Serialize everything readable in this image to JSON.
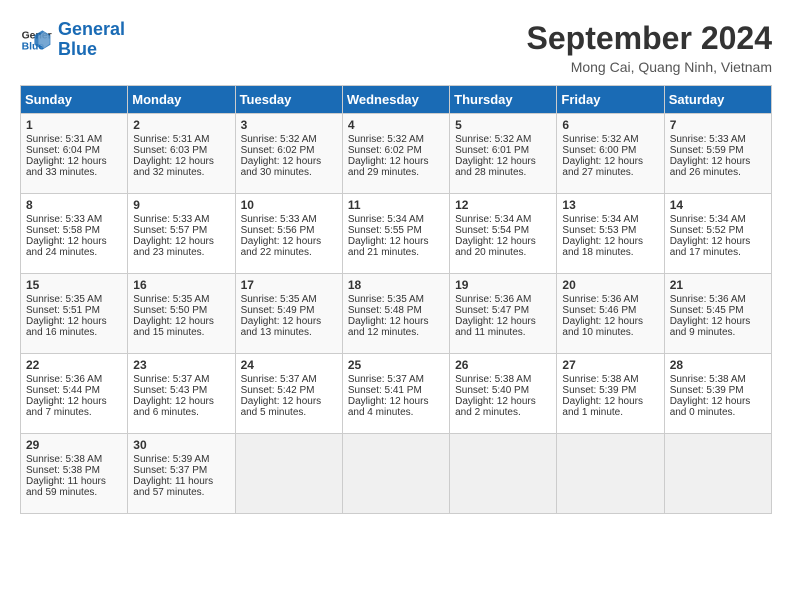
{
  "header": {
    "logo_line1": "General",
    "logo_line2": "Blue",
    "title": "September 2024",
    "subtitle": "Mong Cai, Quang Ninh, Vietnam"
  },
  "weekdays": [
    "Sunday",
    "Monday",
    "Tuesday",
    "Wednesday",
    "Thursday",
    "Friday",
    "Saturday"
  ],
  "weeks": [
    [
      {
        "day": "1",
        "lines": [
          "Sunrise: 5:31 AM",
          "Sunset: 6:04 PM",
          "Daylight: 12 hours",
          "and 33 minutes."
        ]
      },
      {
        "day": "2",
        "lines": [
          "Sunrise: 5:31 AM",
          "Sunset: 6:03 PM",
          "Daylight: 12 hours",
          "and 32 minutes."
        ]
      },
      {
        "day": "3",
        "lines": [
          "Sunrise: 5:32 AM",
          "Sunset: 6:02 PM",
          "Daylight: 12 hours",
          "and 30 minutes."
        ]
      },
      {
        "day": "4",
        "lines": [
          "Sunrise: 5:32 AM",
          "Sunset: 6:02 PM",
          "Daylight: 12 hours",
          "and 29 minutes."
        ]
      },
      {
        "day": "5",
        "lines": [
          "Sunrise: 5:32 AM",
          "Sunset: 6:01 PM",
          "Daylight: 12 hours",
          "and 28 minutes."
        ]
      },
      {
        "day": "6",
        "lines": [
          "Sunrise: 5:32 AM",
          "Sunset: 6:00 PM",
          "Daylight: 12 hours",
          "and 27 minutes."
        ]
      },
      {
        "day": "7",
        "lines": [
          "Sunrise: 5:33 AM",
          "Sunset: 5:59 PM",
          "Daylight: 12 hours",
          "and 26 minutes."
        ]
      }
    ],
    [
      {
        "day": "8",
        "lines": [
          "Sunrise: 5:33 AM",
          "Sunset: 5:58 PM",
          "Daylight: 12 hours",
          "and 24 minutes."
        ]
      },
      {
        "day": "9",
        "lines": [
          "Sunrise: 5:33 AM",
          "Sunset: 5:57 PM",
          "Daylight: 12 hours",
          "and 23 minutes."
        ]
      },
      {
        "day": "10",
        "lines": [
          "Sunrise: 5:33 AM",
          "Sunset: 5:56 PM",
          "Daylight: 12 hours",
          "and 22 minutes."
        ]
      },
      {
        "day": "11",
        "lines": [
          "Sunrise: 5:34 AM",
          "Sunset: 5:55 PM",
          "Daylight: 12 hours",
          "and 21 minutes."
        ]
      },
      {
        "day": "12",
        "lines": [
          "Sunrise: 5:34 AM",
          "Sunset: 5:54 PM",
          "Daylight: 12 hours",
          "and 20 minutes."
        ]
      },
      {
        "day": "13",
        "lines": [
          "Sunrise: 5:34 AM",
          "Sunset: 5:53 PM",
          "Daylight: 12 hours",
          "and 18 minutes."
        ]
      },
      {
        "day": "14",
        "lines": [
          "Sunrise: 5:34 AM",
          "Sunset: 5:52 PM",
          "Daylight: 12 hours",
          "and 17 minutes."
        ]
      }
    ],
    [
      {
        "day": "15",
        "lines": [
          "Sunrise: 5:35 AM",
          "Sunset: 5:51 PM",
          "Daylight: 12 hours",
          "and 16 minutes."
        ]
      },
      {
        "day": "16",
        "lines": [
          "Sunrise: 5:35 AM",
          "Sunset: 5:50 PM",
          "Daylight: 12 hours",
          "and 15 minutes."
        ]
      },
      {
        "day": "17",
        "lines": [
          "Sunrise: 5:35 AM",
          "Sunset: 5:49 PM",
          "Daylight: 12 hours",
          "and 13 minutes."
        ]
      },
      {
        "day": "18",
        "lines": [
          "Sunrise: 5:35 AM",
          "Sunset: 5:48 PM",
          "Daylight: 12 hours",
          "and 12 minutes."
        ]
      },
      {
        "day": "19",
        "lines": [
          "Sunrise: 5:36 AM",
          "Sunset: 5:47 PM",
          "Daylight: 12 hours",
          "and 11 minutes."
        ]
      },
      {
        "day": "20",
        "lines": [
          "Sunrise: 5:36 AM",
          "Sunset: 5:46 PM",
          "Daylight: 12 hours",
          "and 10 minutes."
        ]
      },
      {
        "day": "21",
        "lines": [
          "Sunrise: 5:36 AM",
          "Sunset: 5:45 PM",
          "Daylight: 12 hours",
          "and 9 minutes."
        ]
      }
    ],
    [
      {
        "day": "22",
        "lines": [
          "Sunrise: 5:36 AM",
          "Sunset: 5:44 PM",
          "Daylight: 12 hours",
          "and 7 minutes."
        ]
      },
      {
        "day": "23",
        "lines": [
          "Sunrise: 5:37 AM",
          "Sunset: 5:43 PM",
          "Daylight: 12 hours",
          "and 6 minutes."
        ]
      },
      {
        "day": "24",
        "lines": [
          "Sunrise: 5:37 AM",
          "Sunset: 5:42 PM",
          "Daylight: 12 hours",
          "and 5 minutes."
        ]
      },
      {
        "day": "25",
        "lines": [
          "Sunrise: 5:37 AM",
          "Sunset: 5:41 PM",
          "Daylight: 12 hours",
          "and 4 minutes."
        ]
      },
      {
        "day": "26",
        "lines": [
          "Sunrise: 5:38 AM",
          "Sunset: 5:40 PM",
          "Daylight: 12 hours",
          "and 2 minutes."
        ]
      },
      {
        "day": "27",
        "lines": [
          "Sunrise: 5:38 AM",
          "Sunset: 5:39 PM",
          "Daylight: 12 hours",
          "and 1 minute."
        ]
      },
      {
        "day": "28",
        "lines": [
          "Sunrise: 5:38 AM",
          "Sunset: 5:39 PM",
          "Daylight: 12 hours",
          "and 0 minutes."
        ]
      }
    ],
    [
      {
        "day": "29",
        "lines": [
          "Sunrise: 5:38 AM",
          "Sunset: 5:38 PM",
          "Daylight: 11 hours",
          "and 59 minutes."
        ]
      },
      {
        "day": "30",
        "lines": [
          "Sunrise: 5:39 AM",
          "Sunset: 5:37 PM",
          "Daylight: 11 hours",
          "and 57 minutes."
        ]
      },
      {
        "day": "",
        "lines": []
      },
      {
        "day": "",
        "lines": []
      },
      {
        "day": "",
        "lines": []
      },
      {
        "day": "",
        "lines": []
      },
      {
        "day": "",
        "lines": []
      }
    ]
  ]
}
